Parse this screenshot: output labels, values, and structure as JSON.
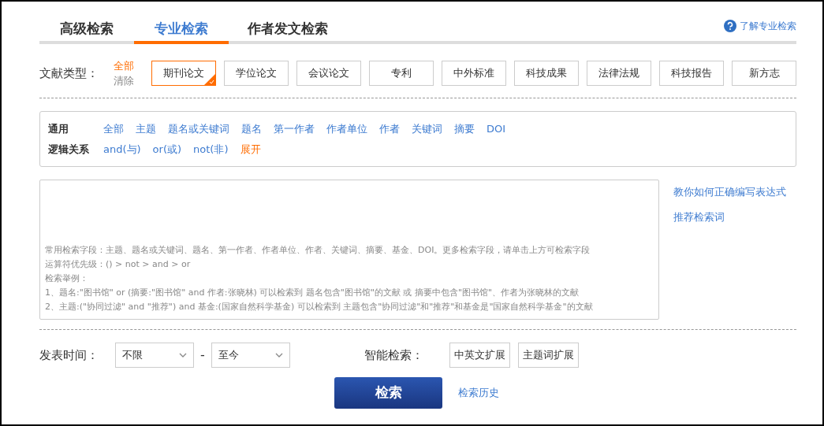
{
  "tabs": [
    {
      "label": "高级检索",
      "selected": false
    },
    {
      "label": "专业检索",
      "selected": true
    },
    {
      "label": "作者发文检索",
      "selected": false
    }
  ],
  "help_link": "了解专业检索",
  "doc_types": {
    "label": "文献类型：",
    "all": "全部",
    "clear": "清除",
    "items": [
      {
        "label": "期刊论文",
        "selected": true
      },
      {
        "label": "学位论文",
        "selected": false
      },
      {
        "label": "会议论文",
        "selected": false
      },
      {
        "label": "专利",
        "selected": false
      },
      {
        "label": "中外标准",
        "selected": false
      },
      {
        "label": "科技成果",
        "selected": false
      },
      {
        "label": "法律法规",
        "selected": false
      },
      {
        "label": "科技报告",
        "selected": false
      },
      {
        "label": "新方志",
        "selected": false
      }
    ]
  },
  "field_panel": {
    "rows": [
      {
        "label": "通用",
        "items": [
          {
            "text": "全部",
            "kind": "link"
          },
          {
            "text": "主题",
            "kind": "link"
          },
          {
            "text": "题名或关键词",
            "kind": "link"
          },
          {
            "text": "题名",
            "kind": "link"
          },
          {
            "text": "第一作者",
            "kind": "link"
          },
          {
            "text": "作者单位",
            "kind": "link"
          },
          {
            "text": "作者",
            "kind": "link"
          },
          {
            "text": "关键词",
            "kind": "link"
          },
          {
            "text": "摘要",
            "kind": "link"
          },
          {
            "text": "DOI",
            "kind": "link"
          }
        ]
      },
      {
        "label": "逻辑关系",
        "items": [
          {
            "text": "and(与)",
            "kind": "link"
          },
          {
            "text": "or(或)",
            "kind": "link"
          },
          {
            "text": "not(非)",
            "kind": "link"
          },
          {
            "text": "展开",
            "kind": "expand"
          }
        ]
      }
    ]
  },
  "query_box": {
    "placeholder_lines": [
      "常用检索字段：主题、题名或关键词、题名、第一作者、作者单位、作者、关键词、摘要、基金、DOI。更多检索字段，请单击上方可检索字段",
      "运算符优先级：() > not > and > or",
      "检索举例：",
      "1、题名:\"图书馆\" or (摘要:\"图书馆\" and 作者:张晓林) 可以检索到 题名包含\"图书馆\"的文献 或 摘要中包含\"图书馆\"、作者为张晓林的文献",
      "2、主题:(\"协同过滤\" and \"推荐\") and 基金:(国家自然科学基金) 可以检索到 主题包含\"协同过滤\"和\"推荐\"和基金是\"国家自然科学基金\"的文献"
    ]
  },
  "side_links": [
    "教你如何正确编写表达式",
    "推荐检索词"
  ],
  "publish_time": {
    "label": "发表时间：",
    "from": "不限",
    "separator": "-",
    "to": "至今"
  },
  "smart_search": {
    "label": "智能检索：",
    "options": [
      {
        "label": "中英文扩展",
        "selected": false
      },
      {
        "label": "主题词扩展",
        "selected": false
      }
    ]
  },
  "search_button": "检索",
  "history_link": "检索历史"
}
